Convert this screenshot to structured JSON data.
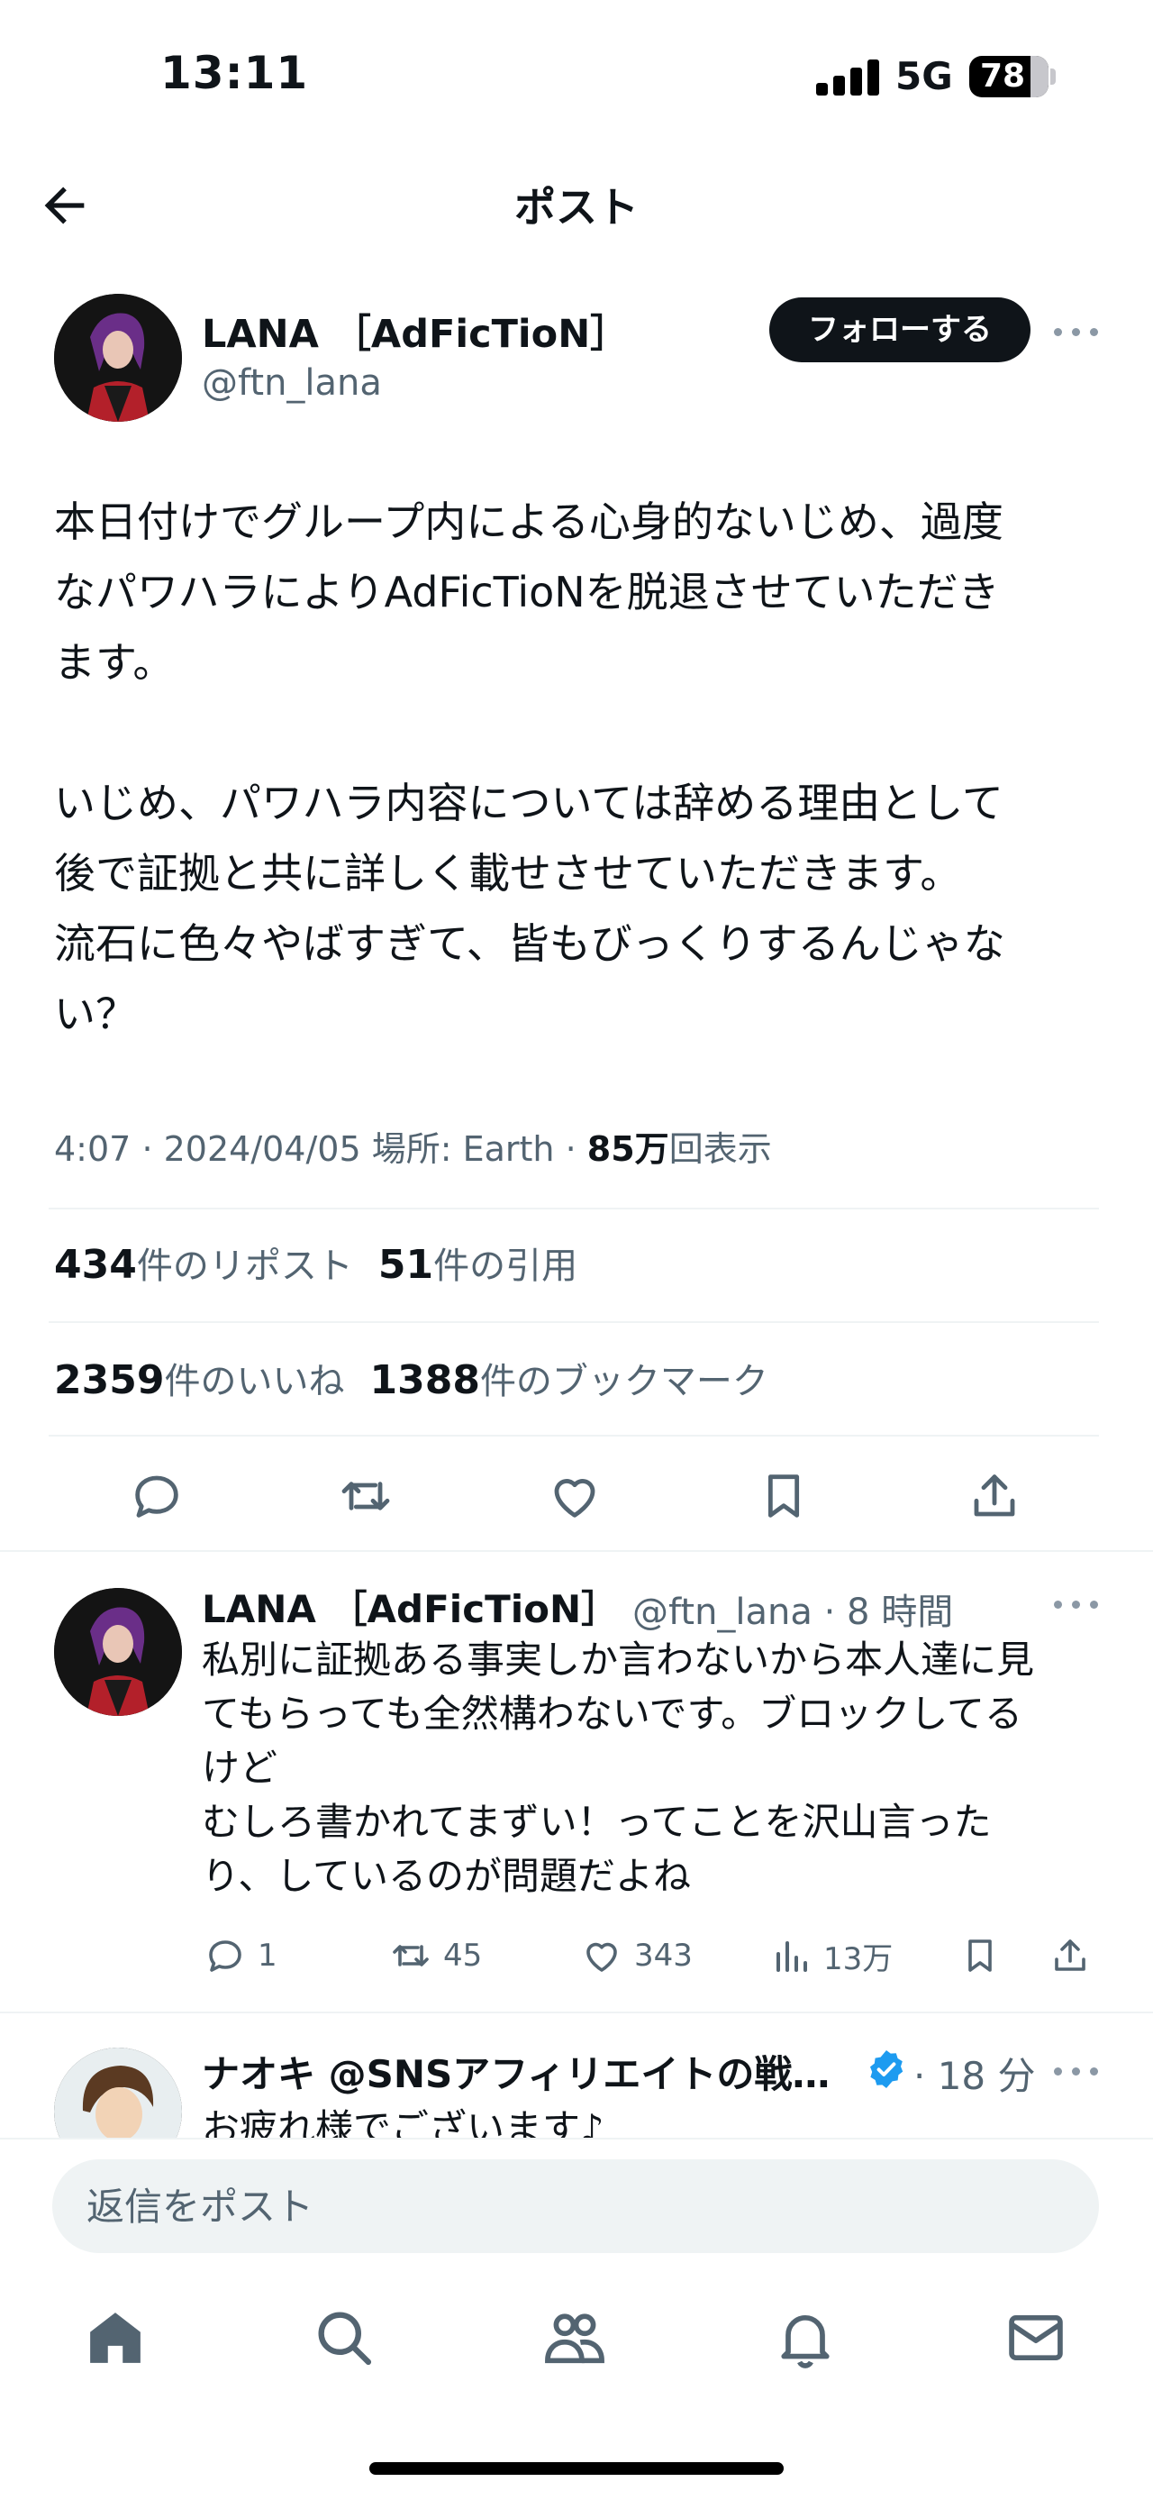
{
  "status_bar": {
    "time": "13:11",
    "network": "5G",
    "battery": "78"
  },
  "header": {
    "title": "ポスト"
  },
  "tweet": {
    "author_name": "LANA ［AdFicTioN］",
    "author_handle": "@ftn_lana",
    "follow_label": "フォローする",
    "body": "本日付けでグループ内による心身的ないじめ、過度\nなパワハラによりAdFicTioNを脱退させていただき\nます。\n\nいじめ、パワハラ内容については辞める理由として\n後で証拠と共に詳しく載せさせていただきます。\n流石に色々やばすぎて、皆もびっくりするんじゃな\nい？",
    "meta": {
      "time": "4:07",
      "date": "2024/04/05",
      "location_label": "場所: Earth",
      "views_count": "85万",
      "views_label": "回表示"
    },
    "stats": {
      "reposts_count": "434",
      "reposts_label": "件のリポスト",
      "quotes_count": "51",
      "quotes_label": "件の引用",
      "likes_count": "2359",
      "likes_label": "件のいいね",
      "bookmarks_count": "1388",
      "bookmarks_label": "件のブックマーク"
    }
  },
  "reply": {
    "author_name": "LANA ［AdFicTioN］",
    "handle_time": "@ftn_lana · 8 時間",
    "body": "私別に証拠ある事実しか言わないから本人達に見\nてもらっても全然構わないです。ブロックしてる\nけど\nむしろ書かれてまずい！ってことを沢山言った\nり、しているのが問題だよね",
    "replies": "1",
    "reposts": "45",
    "likes": "343",
    "views": "13万"
  },
  "third": {
    "author_name": "ナオキ @SNSアフィリエイトの戦…",
    "time": "· 18 分",
    "body": "お疲れ様でございます♪"
  },
  "composer": {
    "placeholder": "返信をポスト"
  },
  "colors": {
    "text": "#0f1419",
    "secondary": "#536471",
    "divider": "#eff3f4",
    "verified": "#1d9bf0"
  },
  "icons": [
    "back-arrow-icon",
    "more-icon",
    "reply-icon",
    "repost-icon",
    "like-icon",
    "bookmark-icon",
    "share-icon",
    "views-icon",
    "verified-icon",
    "home-icon",
    "search-icon",
    "communities-icon",
    "notifications-icon",
    "messages-icon"
  ]
}
